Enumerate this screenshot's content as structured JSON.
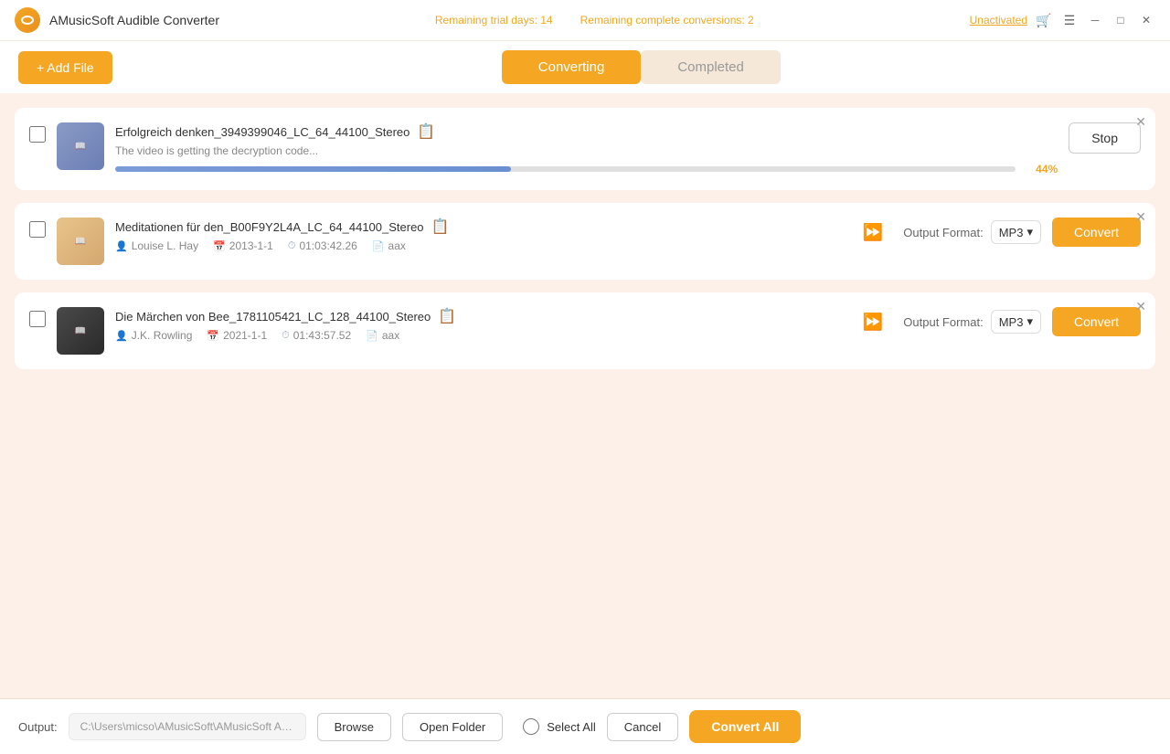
{
  "titlebar": {
    "app_name": "AMusicSoft Audible Converter",
    "trial_days": "Remaining trial days: 14",
    "trial_conversions": "Remaining complete conversions: 2",
    "unactivated": "Unactivated"
  },
  "toolbar": {
    "add_file_label": "+ Add File",
    "tab_converting": "Converting",
    "tab_completed": "Completed"
  },
  "files": [
    {
      "id": 1,
      "title": "Erfolgreich denken_3949399046_LC_64_44100_Stereo",
      "status": "The video is getting the decryption code...",
      "progress": 44,
      "progress_label": "44%",
      "action": "Stop",
      "thumb_type": "thumb-1",
      "thumb_label": "Book"
    },
    {
      "id": 2,
      "title": "Meditationen für den_B00F9Y2L4A_LC_64_44100_Stereo",
      "author": "Louise L. Hay",
      "date": "2013-1-1",
      "duration": "01:03:42.26",
      "format_in": "aax",
      "output_format": "MP3",
      "action": "Convert",
      "thumb_type": "thumb-2",
      "thumb_label": "Book"
    },
    {
      "id": 3,
      "title": "Die Märchen von Bee_1781105421_LC_128_44100_Stereo",
      "author": "J.K. Rowling",
      "date": "2021-1-1",
      "duration": "01:43:57.52",
      "format_in": "aax",
      "output_format": "MP3",
      "action": "Convert",
      "thumb_type": "thumb-3",
      "thumb_label": "Book"
    }
  ],
  "bottombar": {
    "output_label": "Output:",
    "output_path": "C:\\Users\\micso\\AMusicSoft\\AMusicSoft Au...",
    "browse_label": "Browse",
    "open_folder_label": "Open Folder",
    "select_all_label": "Select All",
    "cancel_label": "Cancel",
    "convert_all_label": "Convert All"
  }
}
